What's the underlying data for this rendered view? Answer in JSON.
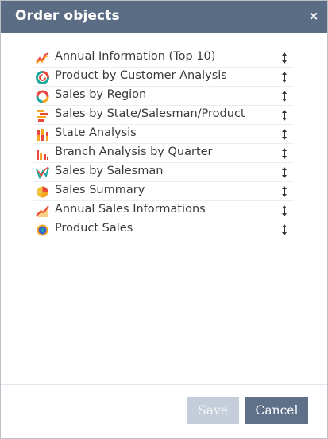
{
  "dialog": {
    "title": "Order objects",
    "close_glyph": "×",
    "items": [
      {
        "label": "Annual Information (Top 10)",
        "icon": "line-chart-icon"
      },
      {
        "label": "Product by Customer Analysis",
        "icon": "donut-chart-icon"
      },
      {
        "label": "Sales by Region",
        "icon": "ring-chart-icon"
      },
      {
        "label": "Sales by State/Salesman/Product",
        "icon": "horizontal-bar-chart-icon"
      },
      {
        "label": "State Analysis",
        "icon": "stacked-bar-chart-icon"
      },
      {
        "label": "Branch Analysis by Quarter",
        "icon": "column-chart-icon"
      },
      {
        "label": "Sales by Salesman",
        "icon": "multi-line-chart-icon"
      },
      {
        "label": "Sales Summary",
        "icon": "pie-chart-icon"
      },
      {
        "label": "Annual Sales Informations",
        "icon": "area-line-chart-icon"
      },
      {
        "label": "Product Sales",
        "icon": "radial-chart-icon"
      }
    ],
    "drag_handle_glyph": "↕",
    "save_label": "Save",
    "cancel_label": "Cancel",
    "save_enabled": false
  },
  "colors": {
    "titlebar": "#5b6d84",
    "cancel_button": "#5f7189",
    "save_button_disabled": "#c4cdd9",
    "label_text": "#3a3a3a"
  }
}
